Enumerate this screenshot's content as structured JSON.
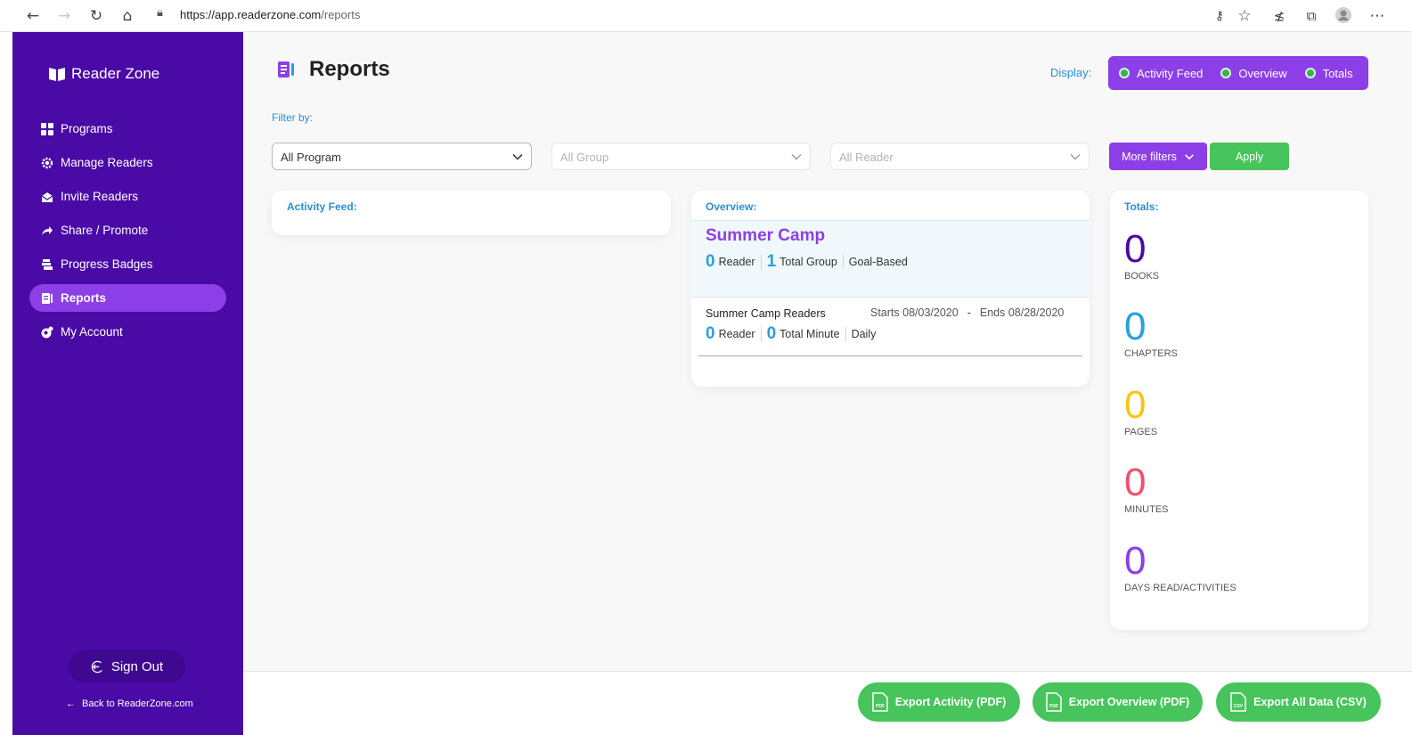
{
  "browser": {
    "url_host": "https://app.readerzone.com",
    "url_path": "/reports"
  },
  "sidebar": {
    "brand": "Reader Zone",
    "items": [
      {
        "label": "Programs",
        "icon": "grid-icon",
        "active": false
      },
      {
        "label": "Manage Readers",
        "icon": "gear-icon",
        "active": false
      },
      {
        "label": "Invite Readers",
        "icon": "envelope-icon",
        "active": false
      },
      {
        "label": "Share / Promote",
        "icon": "share-icon",
        "active": false
      },
      {
        "label": "Progress Badges",
        "icon": "badge-icon",
        "active": false
      },
      {
        "label": "Reports",
        "icon": "report-icon",
        "active": true
      },
      {
        "label": "My Account",
        "icon": "account-icon",
        "active": false
      }
    ],
    "sign_out": "Sign Out",
    "back_link": "Back to ReaderZone.com"
  },
  "header": {
    "title": "Reports",
    "display_label": "Display:",
    "display_options": [
      "Activity Feed",
      "Overview",
      "Totals"
    ]
  },
  "filters": {
    "label": "Filter by:",
    "program": "All Program",
    "group": "All Group",
    "reader": "All Reader",
    "more_filters": "More filters",
    "apply": "Apply"
  },
  "activity_feed": {
    "label": "Activity Feed:"
  },
  "overview": {
    "label": "Overview:",
    "program_name": "Summer Camp",
    "program_readers": "0",
    "program_readers_label": "Reader",
    "program_groups": "1",
    "program_groups_label": "Total Group",
    "program_type": "Goal-Based",
    "group_name": "Summer Camp Readers",
    "starts": "Starts 08/03/2020",
    "dash": "-",
    "ends": "Ends 08/28/2020",
    "group_readers": "0",
    "group_readers_label": "Reader",
    "group_minutes": "0",
    "group_minutes_label": "Total Minute",
    "group_frequency": "Daily"
  },
  "totals": {
    "label": "Totals:",
    "items": [
      {
        "value": "0",
        "label": "BOOKS",
        "color": "#4a0aa6"
      },
      {
        "value": "0",
        "label": "CHAPTERS",
        "color": "#2a9fd9"
      },
      {
        "value": "0",
        "label": "PAGES",
        "color": "#f5c518"
      },
      {
        "value": "0",
        "label": "MINUTES",
        "color": "#f0506e"
      },
      {
        "value": "0",
        "label": "DAYS READ/ACTIVITIES",
        "color": "#8c3fe6"
      }
    ]
  },
  "footer": {
    "export_activity": "Export Activity (PDF)",
    "export_overview": "Export Overview (PDF)",
    "export_all": "Export All Data (CSV)",
    "pdf_tag": "PDF",
    "csv_tag": "CSV"
  },
  "colors": {
    "sidebar": "#4a0aa6",
    "accent": "#8c3fe6",
    "link_blue": "#2a8fcf",
    "green": "#47c45b"
  }
}
